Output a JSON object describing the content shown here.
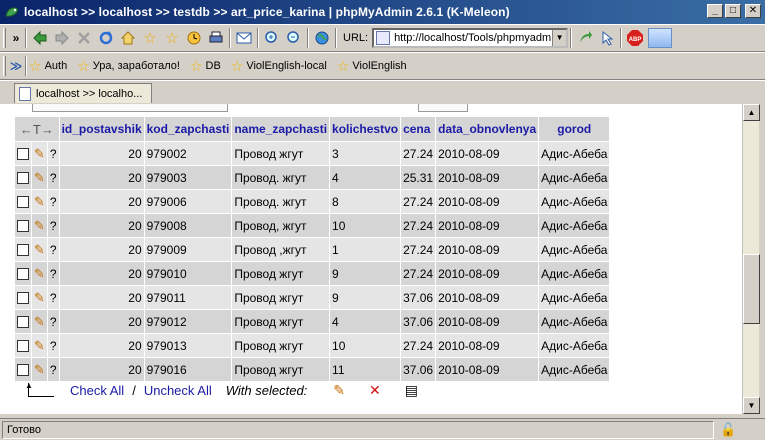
{
  "window": {
    "title": "localhost >> localhost >> testdb  >> art_price_karina | phpMyAdmin 2.6.1 (K-Meleon)",
    "btn_min": "_",
    "btn_max": "□",
    "btn_close": "✕"
  },
  "toolbar": {
    "chevron": "»",
    "url_label": "URL:",
    "url_value": "http://localhost/Tools/phpmyadm"
  },
  "bookmarks": {
    "chevron": "≫",
    "items": [
      "Auth",
      "Ура, заработало!",
      "DB",
      "ViolEnglish-local",
      "ViolEnglish"
    ]
  },
  "tab": {
    "label": "localhost >> localho..."
  },
  "table": {
    "columns": [
      "id_postavshik",
      "kod_zapchasti",
      "name_zapchasti",
      "kolichestvo",
      "cena",
      "data_obnovlenya",
      "gorod"
    ],
    "rows": [
      [
        "20",
        "979002",
        "Провод жгут",
        "3",
        "27.24",
        "2010-08-09",
        "Адис-Абеба"
      ],
      [
        "20",
        "979003",
        "Провод. жгут",
        "4",
        "25.31",
        "2010-08-09",
        "Адис-Абеба"
      ],
      [
        "20",
        "979006",
        "Провод. жгут",
        "8",
        "27.24",
        "2010-08-09",
        "Адис-Абеба"
      ],
      [
        "20",
        "979008",
        "Провод, жгут",
        "10",
        "27.24",
        "2010-08-09",
        "Адис-Абеба"
      ],
      [
        "20",
        "979009",
        "Провод ,жгут",
        "1",
        "27.24",
        "2010-08-09",
        "Адис-Абеба"
      ],
      [
        "20",
        "979010",
        "Провод жгут",
        "9",
        "27.24",
        "2010-08-09",
        "Адис-Абеба"
      ],
      [
        "20",
        "979011",
        "Провод жгут",
        "9",
        "37.06",
        "2010-08-09",
        "Адис-Абеба"
      ],
      [
        "20",
        "979012",
        "Провод жгут",
        "4",
        "37.06",
        "2010-08-09",
        "Адис-Абеба"
      ],
      [
        "20",
        "979013",
        "Провод жгут",
        "10",
        "27.24",
        "2010-08-09",
        "Адис-Абеба"
      ],
      [
        "20",
        "979016",
        "Провод жгут",
        "11",
        "37.06",
        "2010-08-09",
        "Адис-Абеба"
      ]
    ],
    "row_marker": "?",
    "header_arrows": "←T→"
  },
  "actions": {
    "check_all": "Check All",
    "separator": "/",
    "uncheck_all": "Uncheck All",
    "with_selected": "With selected:"
  },
  "status": {
    "text": "Готово"
  }
}
